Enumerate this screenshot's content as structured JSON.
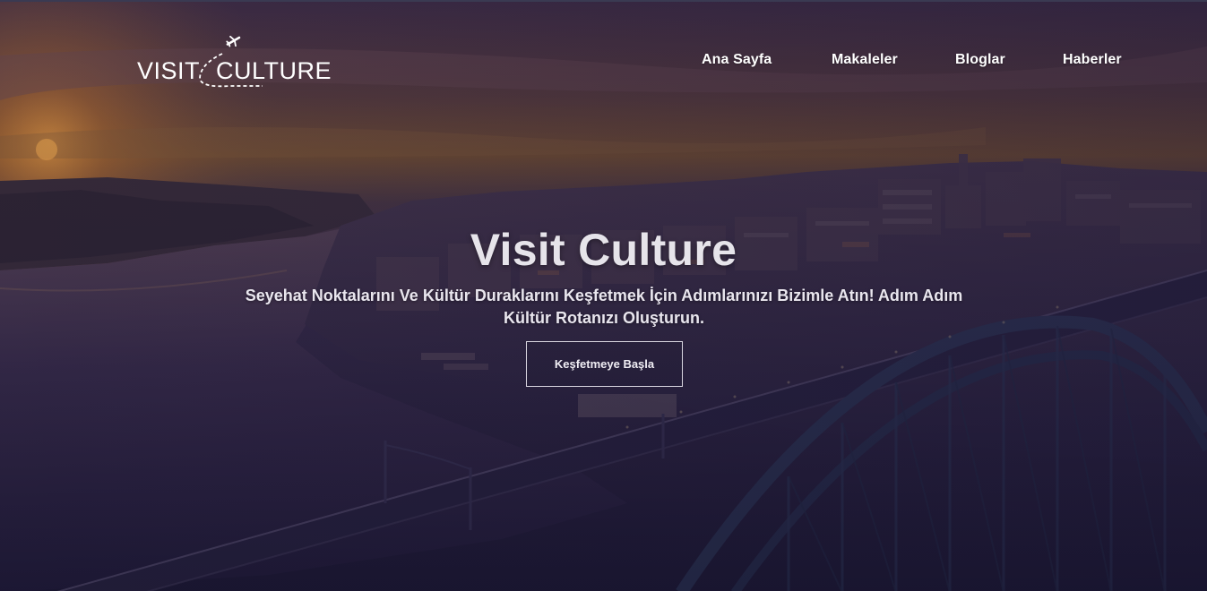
{
  "brand": {
    "logo_text_left": "VISIT",
    "logo_text_right": "CULTURE",
    "logo_icon": "airplane-icon"
  },
  "nav": {
    "items": [
      {
        "label": "Ana Sayfa"
      },
      {
        "label": "Makaleler"
      },
      {
        "label": "Bloglar"
      },
      {
        "label": "Haberler"
      }
    ]
  },
  "hero": {
    "title": "Visit Culture",
    "subtitle": "Seyehat Noktalarını Ve Kültür Duraklarını Keşfetmek İçin Adımlarınızı Bizimle Atın! Adım Adım Kültür Rotanızı Oluşturun.",
    "cta_label": "Keşfetmeye Başla",
    "background": "city-bridge-sunset-photo"
  },
  "colors": {
    "sky_top": "#3e2d45",
    "sunset": "#b4702c",
    "water": "#3a2c4e",
    "overlay": "#1c1636",
    "text": "#ffffff"
  }
}
